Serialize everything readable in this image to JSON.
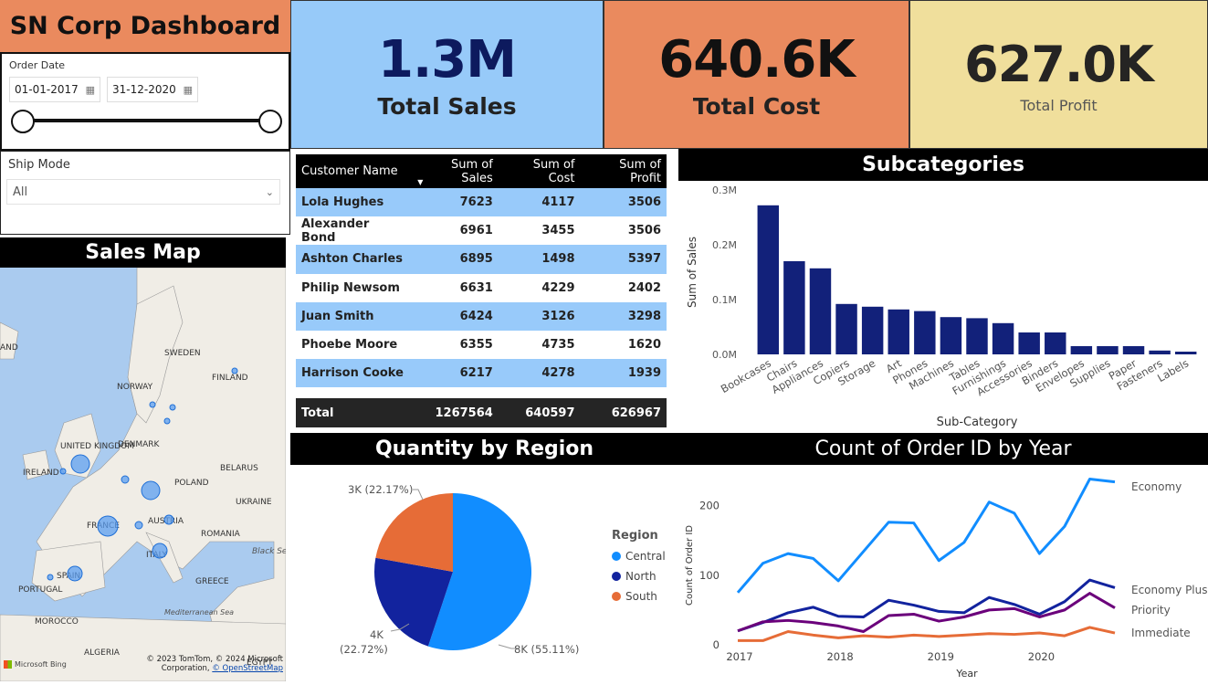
{
  "title": "SN Corp Dashboard",
  "kpis": [
    {
      "value": "1.3M",
      "label": "Total Sales",
      "bg": "#97caf9",
      "value_color": "#0d1a5e"
    },
    {
      "value": "640.6K",
      "label": "Total Cost",
      "bg": "#ea8a5e",
      "value_color": "#111111"
    },
    {
      "value": "627.0K",
      "label": "Total Profit",
      "bg": "#f0df9c",
      "value_color": "#252423"
    }
  ],
  "filters": {
    "order_date": {
      "label": "Order Date",
      "start": "01-01-2017",
      "end": "31-12-2020"
    },
    "ship_mode": {
      "label": "Ship Mode",
      "value": "All"
    }
  },
  "map": {
    "title": "Sales Map",
    "labels": [
      "SWEDEN",
      "FINLAND",
      "NORWAY",
      "UNITED KINGDOM",
      "IRELAND",
      "DENMARK",
      "BELARUS",
      "POLAND",
      "UKRAINE",
      "FRANCE",
      "AUSTRIA",
      "ROMANIA",
      "ITALY",
      "Black Sea",
      "SPAIN",
      "PORTUGAL",
      "GREECE",
      "Mediterranean Sea",
      "MOROCCO",
      "ALGERIA",
      "EGYPT",
      "AND"
    ],
    "attribution": "© 2023 TomTom, © 2024 Microsoft Corporation,",
    "osm": "© OpenStreetMap",
    "bing": "Microsoft Bing"
  },
  "table": {
    "columns": [
      "Customer Name",
      "Sum of Sales",
      "Sum of Cost",
      "Sum of Profit"
    ],
    "rows": [
      [
        "Lola Hughes",
        "7623",
        "4117",
        "3506"
      ],
      [
        "Alexander Bond",
        "6961",
        "3455",
        "3506"
      ],
      [
        "Ashton Charles",
        "6895",
        "1498",
        "5397"
      ],
      [
        "Philip Newsom",
        "6631",
        "4229",
        "2402"
      ],
      [
        "Juan Smith",
        "6424",
        "3126",
        "3298"
      ],
      [
        "Phoebe Moore",
        "6355",
        "4735",
        "1620"
      ],
      [
        "Harrison Cooke",
        "6217",
        "4278",
        "1939"
      ]
    ],
    "total": [
      "Total",
      "1267564",
      "640597",
      "626967"
    ]
  },
  "chart_data": [
    {
      "type": "bar",
      "title": "Subcategories",
      "xlabel": "Sub-Category",
      "ylabel": "Sum of Sales",
      "categories": [
        "Bookcases",
        "Chairs",
        "Appliances",
        "Copiers",
        "Storage",
        "Art",
        "Phones",
        "Machines",
        "Tables",
        "Furnishings",
        "Accessories",
        "Binders",
        "Envelopes",
        "Supplies",
        "Paper",
        "Fasteners",
        "Labels"
      ],
      "values": [
        272000,
        170000,
        157000,
        92000,
        87000,
        82000,
        79000,
        68000,
        66000,
        57000,
        40000,
        40000,
        15000,
        15000,
        15000,
        7000,
        5000
      ],
      "yticks": [
        "0.0M",
        "0.1M",
        "0.2M",
        "0.3M"
      ],
      "ylim": [
        0,
        300000
      ],
      "color": "#12217a"
    },
    {
      "type": "pie",
      "title": "Quantity by Region",
      "legend_title": "Region",
      "slices": [
        {
          "name": "Central",
          "value": 55.11,
          "label": "8K (55.11%)",
          "color": "#118dff"
        },
        {
          "name": "North",
          "value": 22.72,
          "label_line1": "4K",
          "label_line2": "(22.72%)",
          "color": "#12239e"
        },
        {
          "name": "South",
          "value": 22.17,
          "label": "3K (22.17%)",
          "color": "#e66c37"
        }
      ]
    },
    {
      "type": "line",
      "title": "Count of Order ID by Year",
      "xlabel": "Year",
      "ylabel": "Count of Order ID",
      "xticks": [
        "2017",
        "2018",
        "2019",
        "2020"
      ],
      "yticks": [
        "0",
        "100",
        "200"
      ],
      "ylim": [
        0,
        240
      ],
      "series": [
        {
          "name": "Economy",
          "color": "#118dff",
          "values": [
            75,
            117,
            131,
            124,
            92,
            134,
            176,
            175,
            121,
            147,
            205,
            189,
            131,
            170,
            238,
            234
          ]
        },
        {
          "name": "Economy Plus",
          "color": "#12239e",
          "values": [
            20,
            32,
            46,
            54,
            41,
            40,
            64,
            57,
            48,
            46,
            68,
            58,
            44,
            62,
            93,
            82
          ]
        },
        {
          "name": "Priority",
          "color": "#6b007b",
          "values": [
            20,
            33,
            35,
            32,
            27,
            19,
            42,
            44,
            34,
            40,
            50,
            52,
            40,
            50,
            74,
            53
          ]
        },
        {
          "name": "Immediate",
          "color": "#e66c37",
          "values": [
            6,
            6,
            19,
            14,
            10,
            13,
            11,
            14,
            12,
            14,
            16,
            15,
            17,
            13,
            25,
            17
          ]
        }
      ]
    }
  ]
}
